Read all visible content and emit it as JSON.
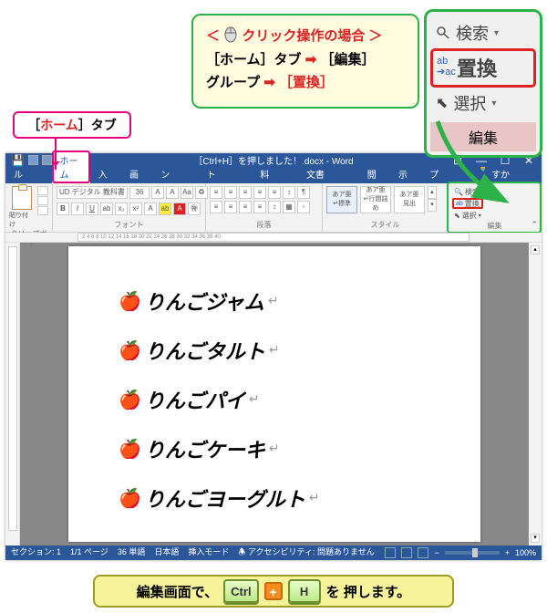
{
  "callouts": {
    "home_tab": {
      "bracket_l": "［",
      "name": "ホーム",
      "bracket_r": "］",
      "suffix": "タブ"
    },
    "click_note": {
      "title_prefix": "＜",
      "title": "クリック操作の場合",
      "title_suffix": "＞",
      "line2_a": "［ホーム］タブ",
      "arrow": "➡",
      "line2_b": "［編集］",
      "line3_a": "グループ",
      "line3_b": "［置換］"
    },
    "edit_group": {
      "find": "検索",
      "replace": "置換",
      "select": "選択",
      "label": "編集",
      "ab_line1": "ab",
      "ab_line2": "➔ac"
    }
  },
  "word": {
    "title": "［Ctrl+H］を押しました！.docx - Word",
    "tabs": {
      "file": "ファイル",
      "home": "ホーム",
      "insert": "挿入",
      "draw": "描画",
      "design": "デザイン",
      "layout": "レイアウト",
      "references": "参考資料",
      "mailings": "差し込み文書",
      "review": "校閲",
      "view": "表示",
      "help": "ヘルプ",
      "tell": "何をしますか"
    },
    "ribbon": {
      "clipboard": "クリップボード",
      "paste": "貼り付け",
      "font_name": "UD デジタル 教科書",
      "font_size": "36",
      "font_label": "フォント",
      "paragraph": "段落",
      "style_normal": "あア亜",
      "style_normal_l": "↵標準",
      "style_nospace": "↵行間詰め",
      "style_heading": "見出",
      "style_label": "スタイル",
      "find": "検索",
      "replace": "置換",
      "select": "選択",
      "edit_label": "編集"
    },
    "doc_lines": [
      "りんごジャム",
      "りんごタルト",
      "りんごパイ",
      "りんごケーキ",
      "りんごヨーグルト"
    ],
    "status": {
      "section": "セクション: 1",
      "page": "1/1 ページ",
      "words": "36 単語",
      "lang": "日本語",
      "insert": "挿入モード",
      "acc": "アクセシビリティ: 問題ありません",
      "zoom": "100%"
    }
  },
  "bottom": {
    "prefix": "編集画面で、",
    "ctrl": "Ctrl",
    "plus": "+",
    "h": "H",
    "suffix": " を 押します。"
  },
  "ruler_marks": "2   4   6   8  10  12  14  16  18  20  22  24  26  28  30  32  34  36  38  40"
}
